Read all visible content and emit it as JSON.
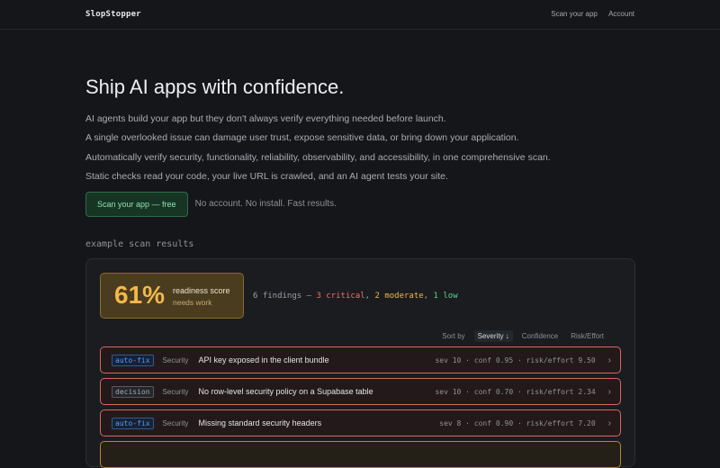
{
  "nav": {
    "brand": "SlopStopper",
    "links": [
      "Scan your app",
      "Account"
    ]
  },
  "hero": {
    "title": "Ship AI apps with confidence.",
    "lines": [
      "AI agents build your app but they don't always verify everything needed before launch.",
      "A single overlooked issue can damage user trust, expose sensitive data, or bring down your application.",
      "Automatically verify security, functionality, reliability, observability, and accessibility, in one comprehensive scan.",
      "Static checks read your code, your live URL is crawled, and an AI agent tests your site."
    ],
    "cta_label": "Scan your app — free",
    "cta_note": "No account. No install. Fast results."
  },
  "example_label": "example scan results",
  "score": {
    "percent": "61%",
    "title": "readiness score",
    "subtitle": "needs work"
  },
  "findings_summary": {
    "prefix": "6 findings — ",
    "critical": "3 critical",
    "sep1": ", ",
    "moderate": "2 moderate",
    "sep2": ", ",
    "low": "1 low"
  },
  "sort": {
    "label": "Sort by",
    "options": [
      "Severity ↓",
      "Confidence",
      "Risk/Effort"
    ]
  },
  "rows": [
    {
      "tag": "auto-fix",
      "category": "Security",
      "title": "API key exposed in the client bundle",
      "meta": "sev 10 · conf 0.95 · risk/effort 9.50"
    },
    {
      "tag": "decision",
      "category": "Security",
      "title": "No row-level security policy on a Supabase table",
      "meta": "sev 10 · conf 0.70 · risk/effort 2.34"
    },
    {
      "tag": "auto-fix",
      "category": "Security",
      "title": "Missing standard security headers",
      "meta": "sev 8 · conf 0.90 · risk/effort 7.20"
    }
  ],
  "colors": {
    "critical": "#ff6b6b",
    "moderate": "#f2b84b",
    "low": "#5fd38b",
    "accent": "#8fe0ab"
  }
}
